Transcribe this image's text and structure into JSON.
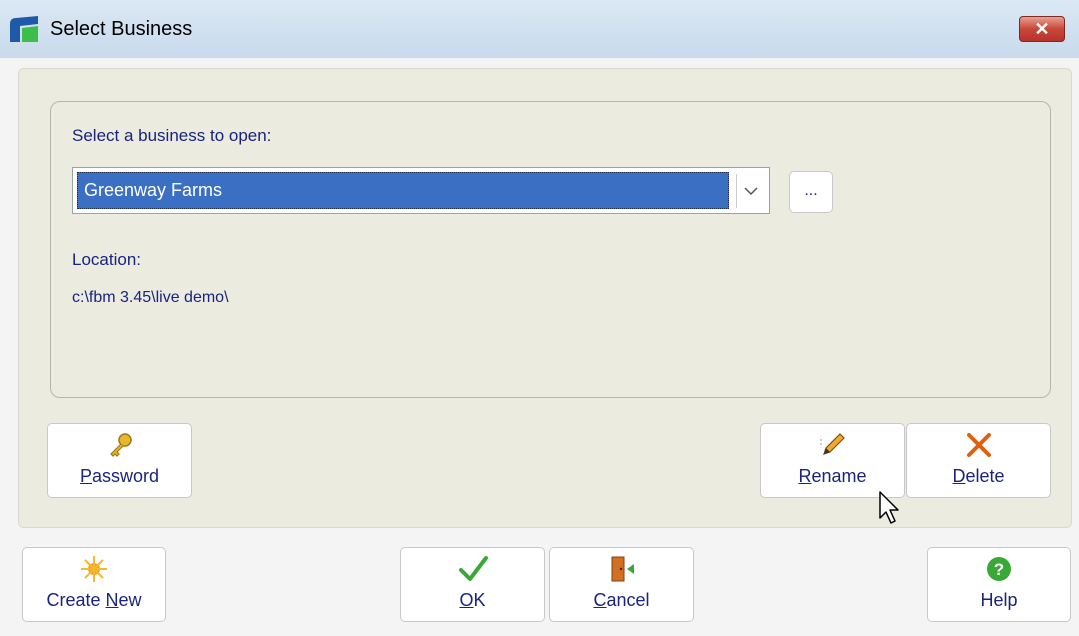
{
  "window": {
    "title": "Select Business",
    "close_label": "✕"
  },
  "form": {
    "prompt_label": "Select a business to open:",
    "selected_business": "Greenway Farms",
    "browse_label": "...",
    "location_label": "Location:",
    "location_value": "c:\\fbm 3.45\\live demo\\"
  },
  "buttons": {
    "password": {
      "pre": "",
      "key": "P",
      "post": "assword"
    },
    "rename": {
      "pre": "",
      "key": "R",
      "post": "ename"
    },
    "delete": {
      "pre": "",
      "key": "D",
      "post": "elete"
    },
    "create_new": {
      "pre": "Create ",
      "key": "N",
      "post": "ew"
    },
    "ok": {
      "pre": "",
      "key": "O",
      "post": "K"
    },
    "cancel": {
      "pre": "",
      "key": "C",
      "post": "ancel"
    },
    "help": {
      "label": "Help"
    }
  },
  "colors": {
    "selection": "#3b6fc4",
    "label_text": "#1a237e",
    "panel": "#ecebe0"
  }
}
